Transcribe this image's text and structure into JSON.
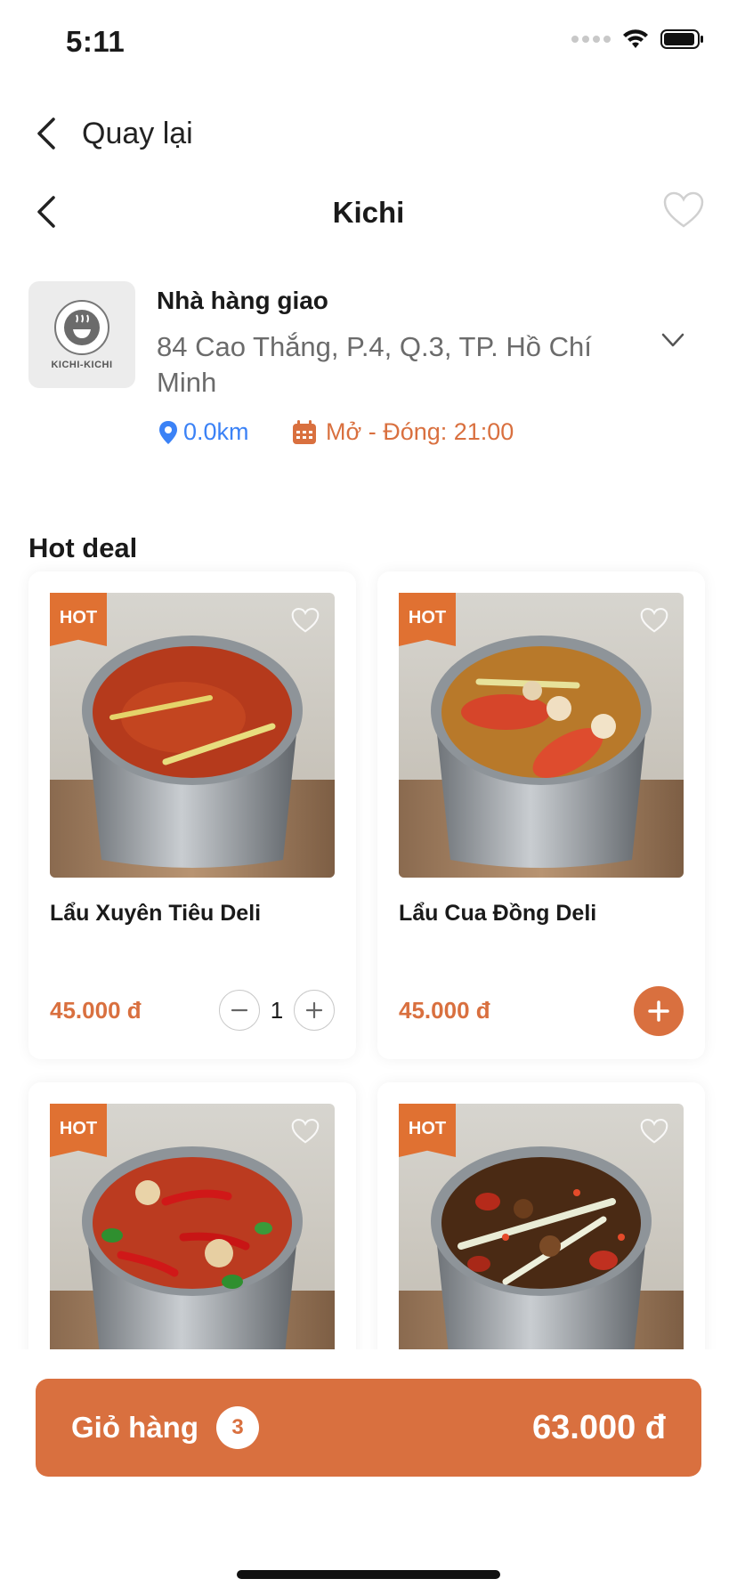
{
  "status_bar": {
    "time": "5:11"
  },
  "nav": {
    "back_label": "Quay lại",
    "title": "Kichi"
  },
  "store": {
    "logo_text": "KICHI-KICHI",
    "type": "Nhà hàng giao",
    "address": "84 Cao Thắng, P.4, Q.3, TP. Hồ Chí Minh",
    "distance": "0.0km",
    "hours": "Mở - Đóng: 21:00"
  },
  "section": {
    "title": "Hot deal"
  },
  "products": [
    {
      "name": "Lẩu Xuyên Tiêu Deli",
      "price": "45.000 đ",
      "badge": "HOT",
      "quantity": "1"
    },
    {
      "name": "Lẩu Cua Đồng Deli",
      "price": "45.000 đ",
      "badge": "HOT"
    },
    {
      "name": "",
      "price": "",
      "badge": "HOT"
    },
    {
      "name": "",
      "price": "",
      "badge": "HOT"
    }
  ],
  "cart": {
    "label": "Giỏ hàng",
    "count": "3",
    "total": "63.000 đ"
  },
  "colors": {
    "accent": "#d9703f",
    "distance": "#3b82f6",
    "hot_tag": "#e07132"
  }
}
